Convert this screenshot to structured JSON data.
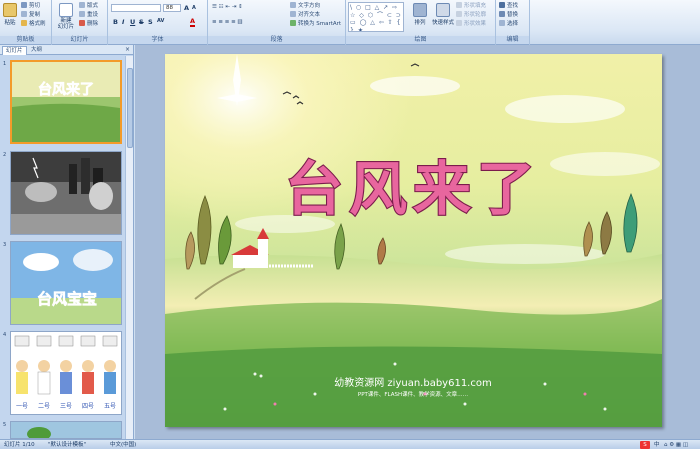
{
  "ribbon": {
    "clipboard": {
      "paste": "粘贴",
      "cut": "剪切",
      "copy": "复制",
      "format_painter": "格式刷",
      "label": "剪贴板"
    },
    "slides": {
      "new_slide": "新建\n幻灯片",
      "layout": "版式",
      "reset": "重设",
      "delete": "删除",
      "label": "幻灯片"
    },
    "font": {
      "font_size": "88",
      "label": "字体"
    },
    "paragraph": {
      "text_direction": "文字方向",
      "align_text": "对齐文本",
      "convert_smartart": "转换为 SmartArt",
      "label": "段落"
    },
    "drawing": {
      "shapes": "\\ ○ □ △ ↗ ⇨ ☆ ◇ ⬡ ⌒ ⊂ ⊃ ▭ ◯ △ ⇦ ⇧ { } ★",
      "arrange": "排列",
      "quick_styles": "快速样式",
      "shape_fill": "形状填充",
      "shape_outline": "形状轮廓",
      "shape_effects": "形状效果",
      "label": "绘图"
    },
    "editing": {
      "find": "查找",
      "replace": "替换",
      "select": "选择",
      "label": "编辑"
    }
  },
  "left_pane": {
    "tabs": [
      "幻灯片",
      "大纲"
    ],
    "close": "×",
    "thumbnails": [
      {
        "num": "1",
        "title": "台风来了"
      },
      {
        "num": "2",
        "title": ""
      },
      {
        "num": "3",
        "title": "台风宝宝"
      },
      {
        "num": "4",
        "labels": [
          "一号",
          "二号",
          "三号",
          "四号",
          "五号"
        ]
      },
      {
        "num": "5",
        "title": ""
      }
    ]
  },
  "slide": {
    "title": "台风来了",
    "watermark_main": "幼教资源网 ziyuan.baby611.com",
    "watermark_sub": "PPT课件、FLASH课件、教学资源、文章……"
  },
  "status": {
    "slide_counter": "幻灯片 1/10",
    "theme": "\"默认设计模板\"",
    "language": "中文(中国)",
    "ime": "中"
  },
  "colors": {
    "selection": "#f39b2a",
    "ribbon_bg": "#dbe7f5"
  }
}
